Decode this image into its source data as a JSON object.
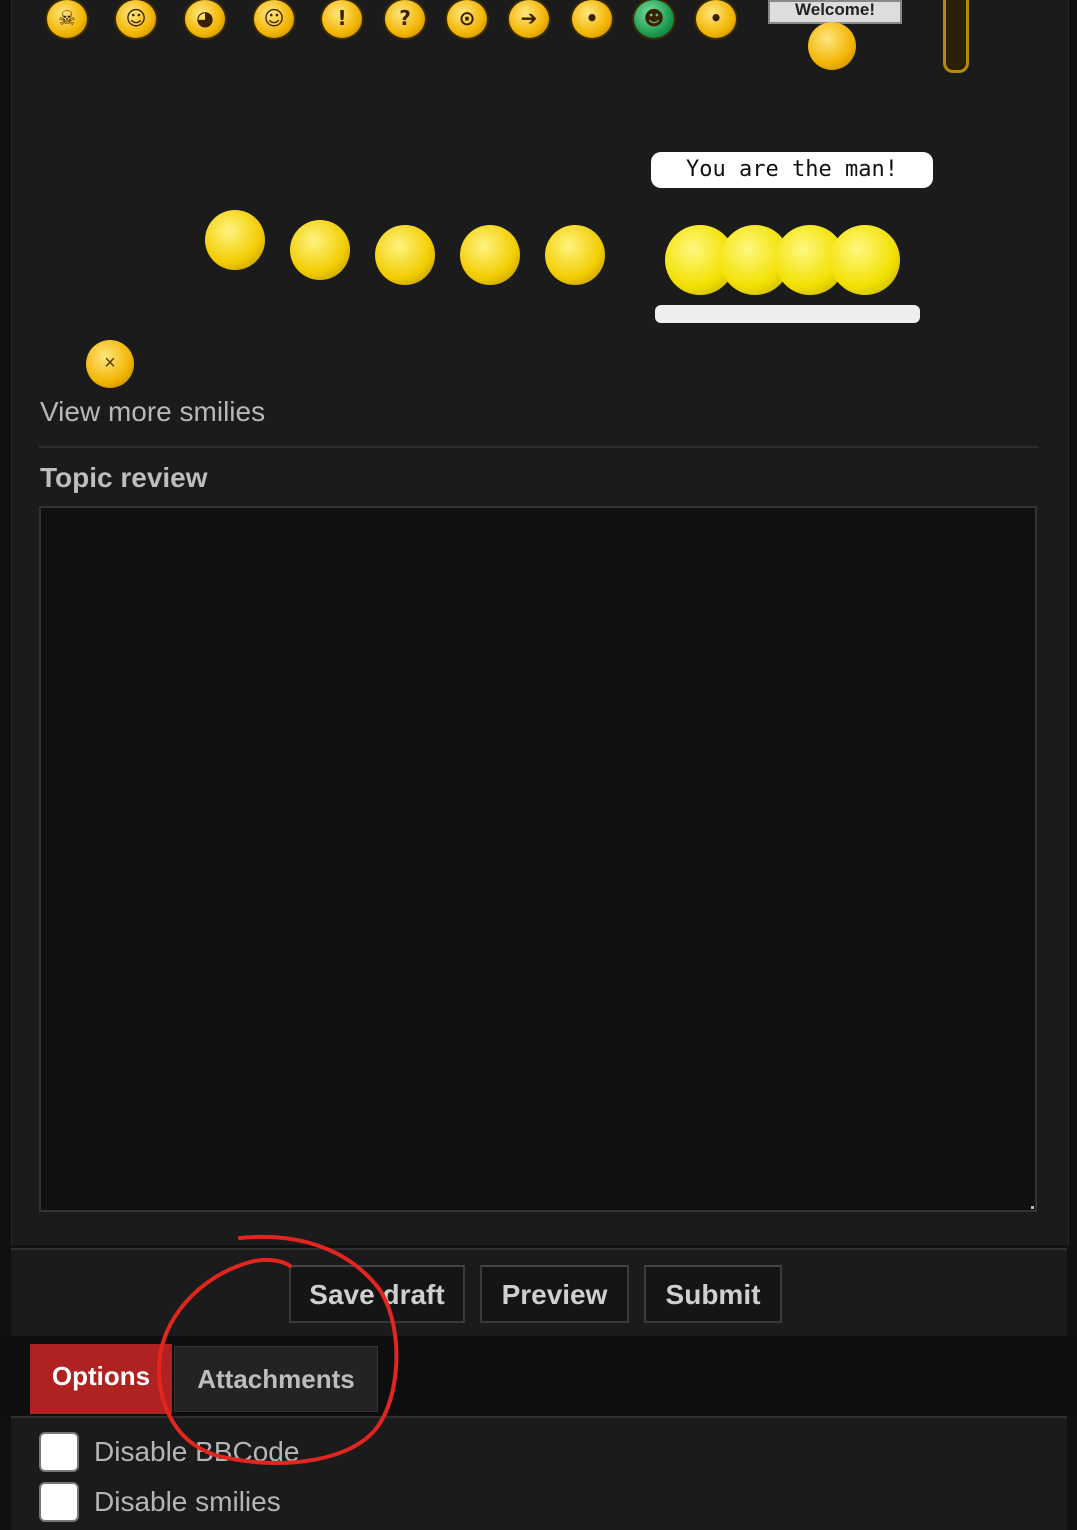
{
  "smilies_row": {
    "items": [
      {
        "icon": "angry-icon",
        "glyph": "☠"
      },
      {
        "icon": "thumbs-down-icon",
        "glyph": "☺"
      },
      {
        "icon": "rolling-eyes-icon",
        "glyph": "◕"
      },
      {
        "icon": "thumbs-up-icon",
        "glyph": "☺"
      },
      {
        "icon": "exclamation-icon",
        "glyph": "!"
      },
      {
        "icon": "question-icon",
        "glyph": "?"
      },
      {
        "icon": "idea-icon",
        "glyph": "⊙"
      },
      {
        "icon": "arrow-icon",
        "glyph": "➔"
      },
      {
        "icon": "neutral-icon",
        "glyph": "•"
      },
      {
        "icon": "mr-green-icon",
        "glyph": "☻"
      },
      {
        "icon": "suspicious-icon",
        "glyph": "•"
      }
    ],
    "welcome_sign": "Welcome!"
  },
  "speech_bubble": "You are the man!",
  "view_more_smilies": "View more smilies",
  "topic_review": {
    "title": "Topic review"
  },
  "buttons": {
    "save_draft": "Save draft",
    "preview": "Preview",
    "submit": "Submit"
  },
  "tabs": {
    "options": "Options",
    "attachments": "Attachments"
  },
  "options": {
    "disable_bbcode": "Disable BBCode",
    "disable_smilies": "Disable smilies"
  },
  "colors": {
    "accent": "#b02222",
    "annotation": "#e0261f"
  }
}
